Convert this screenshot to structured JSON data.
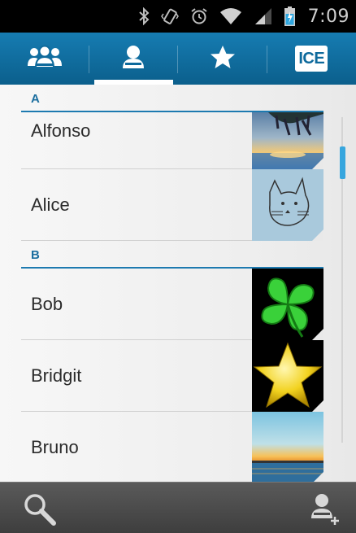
{
  "status_bar": {
    "time": "7:09",
    "icons": [
      "bluetooth-icon",
      "vibrate-icon",
      "alarm-icon",
      "wifi-icon",
      "signal-icon",
      "battery-icon"
    ]
  },
  "tabs": [
    {
      "name": "groups",
      "icon": "groups-icon",
      "selected": false
    },
    {
      "name": "contacts",
      "icon": "person-icon",
      "selected": true
    },
    {
      "name": "favorites",
      "icon": "star-icon",
      "selected": false
    },
    {
      "name": "ice",
      "label": "ICE",
      "selected": false
    }
  ],
  "sections": [
    {
      "letter": "A",
      "contacts": [
        {
          "name": "Alfonso",
          "photo": "sunset-with-branches"
        },
        {
          "name": "Alice",
          "photo": "cat-sketch"
        }
      ]
    },
    {
      "letter": "B",
      "contacts": [
        {
          "name": "Bob",
          "photo": "green-clover"
        },
        {
          "name": "Bridgit",
          "photo": "yellow-star"
        },
        {
          "name": "Bruno",
          "photo": "sunset-over-water"
        }
      ]
    }
  ],
  "bottom_bar": {
    "left_icon": "search-icon",
    "right_icon": "add-contact-icon"
  },
  "colors": {
    "accent": "#1d7ab0",
    "tab_bar": "#0e6a9c",
    "scroll_thumb": "#37a6de"
  }
}
